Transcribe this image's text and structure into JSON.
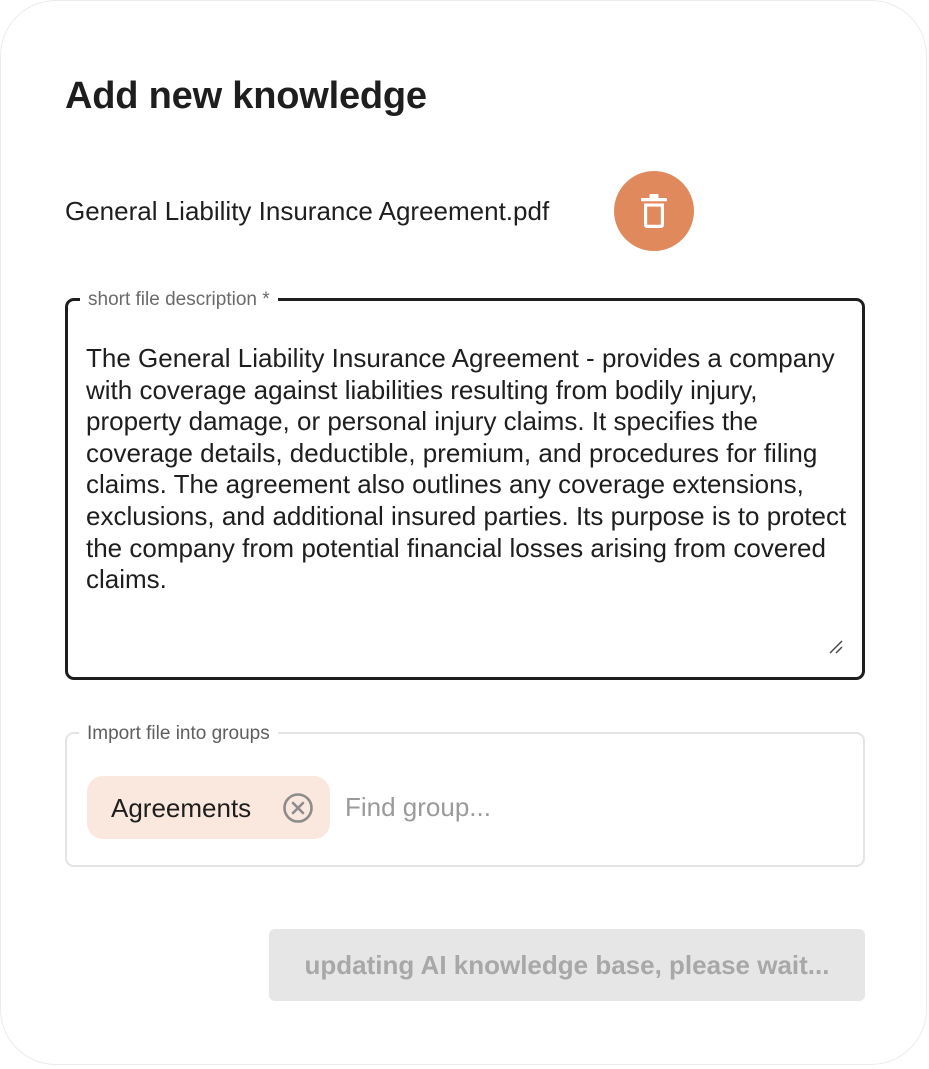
{
  "dialog": {
    "title": "Add new knowledge"
  },
  "file": {
    "name": "General Liability Insurance Agreement.pdf",
    "delete_icon": "trash-icon",
    "delete_color": "#e0895c"
  },
  "description": {
    "label": "short file description *",
    "value": "The General Liability Insurance Agreement - provides a company with coverage against liabilities resulting from bodily injury, property damage, or personal injury claims. It specifies the coverage details, deductible, premium, and procedures for filing claims. The agreement also outlines any coverage extensions, exclusions, and additional insured parties. Its purpose is to protect the company from potential financial losses arising from covered claims."
  },
  "groups": {
    "label": "Import file into groups",
    "selected": [
      {
        "label": "Agreements",
        "remove_icon": "close-circle-icon"
      }
    ],
    "search_placeholder": "Find group...",
    "chip_color": "#fae8de"
  },
  "submit": {
    "label": "updating AI knowledge base, please wait...",
    "disabled": true
  }
}
